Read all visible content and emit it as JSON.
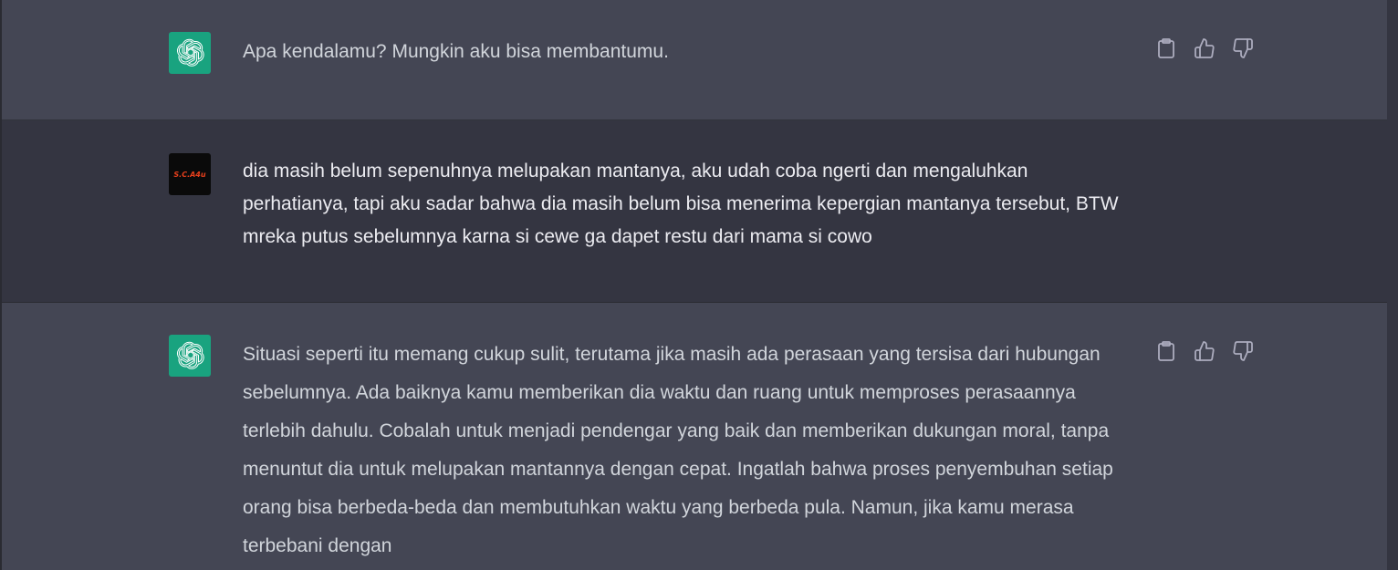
{
  "messages": [
    {
      "role": "assistant",
      "avatar_icon": "openai-logo-icon",
      "text": "Apa kendalamu? Mungkin aku bisa membantumu.",
      "actions": [
        "copy-icon",
        "thumbs-up-icon",
        "thumbs-down-icon"
      ]
    },
    {
      "role": "user",
      "avatar_text": "S.C.A4u",
      "text": "dia masih belum sepenuhnya melupakan mantanya, aku udah coba ngerti dan mengaluhkan perhatianya, tapi aku sadar bahwa dia masih belum bisa menerima kepergian mantanya tersebut, BTW mreka putus sebelumnya karna si cewe ga dapet restu dari mama si cowo"
    },
    {
      "role": "assistant",
      "avatar_icon": "openai-logo-icon",
      "text": "Situasi seperti itu memang cukup sulit, terutama jika masih ada perasaan yang tersisa dari hubungan sebelumnya. Ada baiknya kamu memberikan dia waktu dan ruang untuk memproses perasaannya terlebih dahulu. Cobalah untuk menjadi pendengar yang baik dan memberikan dukungan moral, tanpa menuntut dia untuk melupakan mantannya dengan cepat. Ingatlah bahwa proses penyembuhan setiap orang bisa berbeda-beda dan membutuhkan waktu yang berbeda pula. Namun, jika kamu merasa terbebani dengan",
      "actions": [
        "copy-icon",
        "thumbs-up-icon",
        "thumbs-down-icon"
      ]
    }
  ],
  "colors": {
    "assistant_bg": "#444654",
    "user_bg": "#343541",
    "bot_avatar_bg": "#19a37f",
    "user_avatar_text": "#e8401c"
  }
}
